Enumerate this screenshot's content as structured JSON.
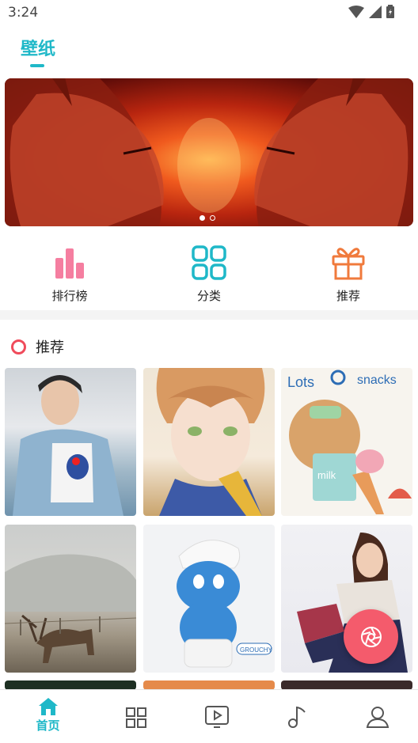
{
  "status_bar": {
    "time": "3:24"
  },
  "header": {
    "active_tab": "壁纸"
  },
  "banner": {
    "pages": 2,
    "active_page": 1
  },
  "quick_actions": [
    {
      "label": "排行榜",
      "icon": "bar-chart-icon",
      "color": "#f57ea0"
    },
    {
      "label": "分类",
      "icon": "grid-icon",
      "color": "#1fb8c8"
    },
    {
      "label": "推荐",
      "icon": "gift-icon",
      "color": "#f07a3c"
    }
  ],
  "recommend_section": {
    "title": "推荐"
  },
  "wallpapers": [
    {
      "name": "young man in denim jacket"
    },
    {
      "name": "anime boy with earphones"
    },
    {
      "name": "lots of snacks bear"
    },
    {
      "name": "deer in misty field"
    },
    {
      "name": "grouchy smurf"
    },
    {
      "name": "girl in hanbok"
    }
  ],
  "bottom_nav": {
    "items": [
      {
        "label": "首页",
        "icon": "home-icon",
        "active": true
      },
      {
        "label": "",
        "icon": "category-icon",
        "active": false
      },
      {
        "label": "",
        "icon": "video-icon",
        "active": false
      },
      {
        "label": "",
        "icon": "music-note-icon",
        "active": false
      },
      {
        "label": "",
        "icon": "user-icon",
        "active": false
      }
    ]
  },
  "colors": {
    "accent": "#1fb8c8",
    "fab": "#f45b6c",
    "ring": "#f04b5b"
  }
}
